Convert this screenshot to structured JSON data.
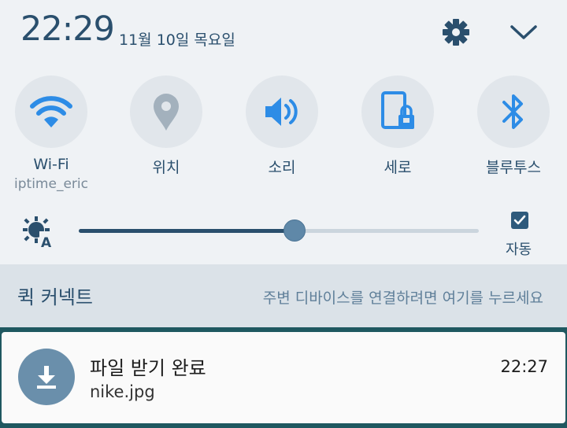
{
  "header": {
    "time": "22:29",
    "date": "11월 10일 목요일",
    "icons": [
      "gear-icon",
      "chevron-down-icon"
    ]
  },
  "tiles": [
    {
      "label": "Wi-Fi",
      "sub": "iptime_eric",
      "icon": "wifi-icon",
      "active": true
    },
    {
      "label": "위치",
      "sub": "",
      "icon": "location-pin-icon",
      "active": false
    },
    {
      "label": "소리",
      "sub": "",
      "icon": "speaker-icon",
      "active": true
    },
    {
      "label": "세로",
      "sub": "",
      "icon": "rotation-lock-icon",
      "active": true
    },
    {
      "label": "블루투스",
      "sub": "",
      "icon": "bluetooth-icon",
      "active": true
    }
  ],
  "brightness": {
    "level": 0.54,
    "auto_label": "자동",
    "auto_checked": true
  },
  "quick_connect": {
    "title": "퀵 커넥트",
    "hint": "주변 디바이스를 연결하려면 여기를 누르세요"
  },
  "notification": {
    "title": "파일 받기 완료",
    "filename": "nike.jpg",
    "time": "22:27",
    "icon": "download-icon"
  },
  "colors": {
    "active_icon": "#2d8ce6",
    "inactive_icon": "#a3b1bd",
    "text_primary": "#2a4f6d"
  }
}
